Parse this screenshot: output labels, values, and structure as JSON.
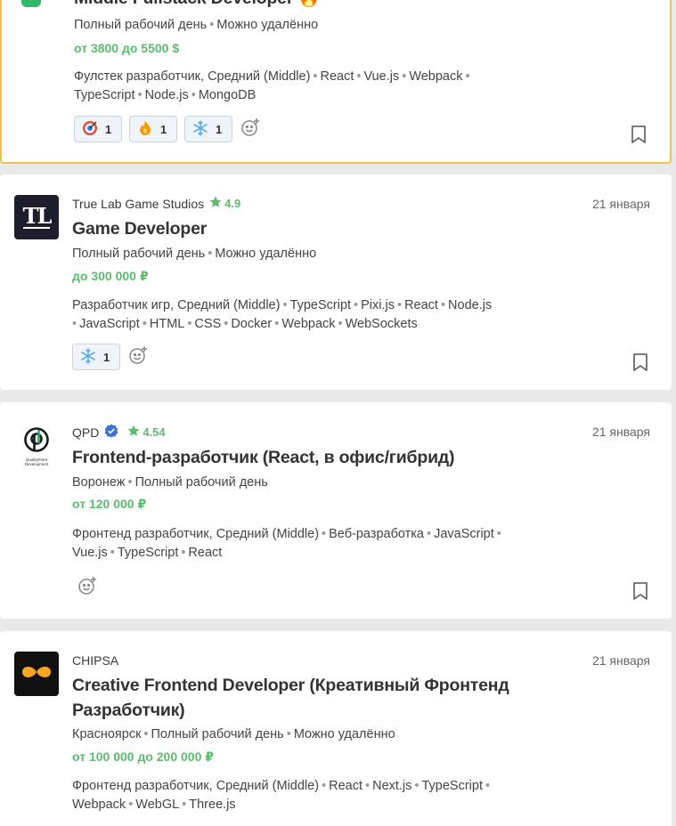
{
  "cards": [
    {
      "title": "Middle Fullstack Developer",
      "title_emoji": "🔥",
      "meta": [
        "Полный рабочий день",
        "Можно удалённо"
      ],
      "salary": "от 3800 до 5500 $",
      "skills": [
        "Фулстек разработчик, Средний (Middle)",
        "React",
        "Vue.js",
        "Webpack",
        "TypeScript",
        "Node.js",
        "MongoDB"
      ],
      "reactions": [
        {
          "icon": "target-icon",
          "count": "1"
        },
        {
          "icon": "fire-icon",
          "count": "1"
        },
        {
          "icon": "snowflake-icon",
          "count": "1"
        }
      ]
    },
    {
      "company": "True Lab Game Studios",
      "logo_text": "TL",
      "rating": "4.9",
      "date": "21 января",
      "title": "Game Developer",
      "meta": [
        "Полный рабочий день",
        "Можно удалённо"
      ],
      "salary": "до 300 000 ₽",
      "skills": [
        "Разработчик игр, Средний (Middle)",
        "TypeScript",
        "Pixi.js",
        "React",
        "Node.js",
        "JavaScript",
        "HTML",
        "CSS",
        "Docker",
        "Webpack",
        "WebSockets"
      ],
      "reactions": [
        {
          "icon": "snowflake-icon",
          "count": "1"
        }
      ]
    },
    {
      "company": "QPD",
      "verified": true,
      "rating": "4.54",
      "date": "21 января",
      "title": "Frontend-разработчик (React, в офис/гибрид)",
      "meta": [
        "Воронеж",
        "Полный рабочий день"
      ],
      "salary": "от 120 000 ₽",
      "skills": [
        "Фронтенд разработчик, Средний (Middle)",
        "Веб-разработка",
        "JavaScript",
        "Vue.js",
        "TypeScript",
        "React"
      ],
      "reactions": []
    },
    {
      "company": "CHIPSA",
      "date": "21 января",
      "title": "Creative Frontend Developer (Креативный Фронтенд Разработчик)",
      "meta": [
        "Красноярск",
        "Полный рабочий день",
        "Можно удалённо"
      ],
      "salary": "от 100 000 до 200 000 ₽",
      "skills": [
        "Фронтенд разработчик, Средний (Middle)",
        "React",
        "Next.js",
        "TypeScript",
        "Webpack",
        "WebGL",
        "Three.js"
      ],
      "reactions": []
    }
  ],
  "logo_small_text": [
    "QualityPoint",
    "Development"
  ],
  "colors": {
    "accent_green": "#5dbb6e",
    "highlight_border": "#f0c34a",
    "verified_blue": "#3f6fd8"
  }
}
